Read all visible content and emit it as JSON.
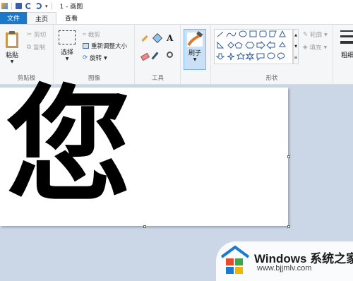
{
  "titlebar": {
    "title": "1 - 画图"
  },
  "tabs": {
    "file": "文件",
    "home": "主页",
    "view": "查看"
  },
  "clipboard": {
    "paste": "粘贴",
    "cut": "剪切",
    "copy": "复制",
    "group": "剪贴板"
  },
  "image": {
    "select": "选择",
    "crop": "裁剪",
    "resize": "重新调整大小",
    "rotate": "旋转",
    "group": "图像"
  },
  "tools": {
    "group": "工具"
  },
  "brushes": {
    "label": "刷子"
  },
  "shapes": {
    "outline": "轮廓",
    "fill": "填充",
    "group": "形状"
  },
  "size": {
    "label": "粗细"
  },
  "canvas": {
    "character": "您"
  },
  "watermark": {
    "brand": "Windows 系统之家",
    "url": "www.bjjmlv.com"
  }
}
